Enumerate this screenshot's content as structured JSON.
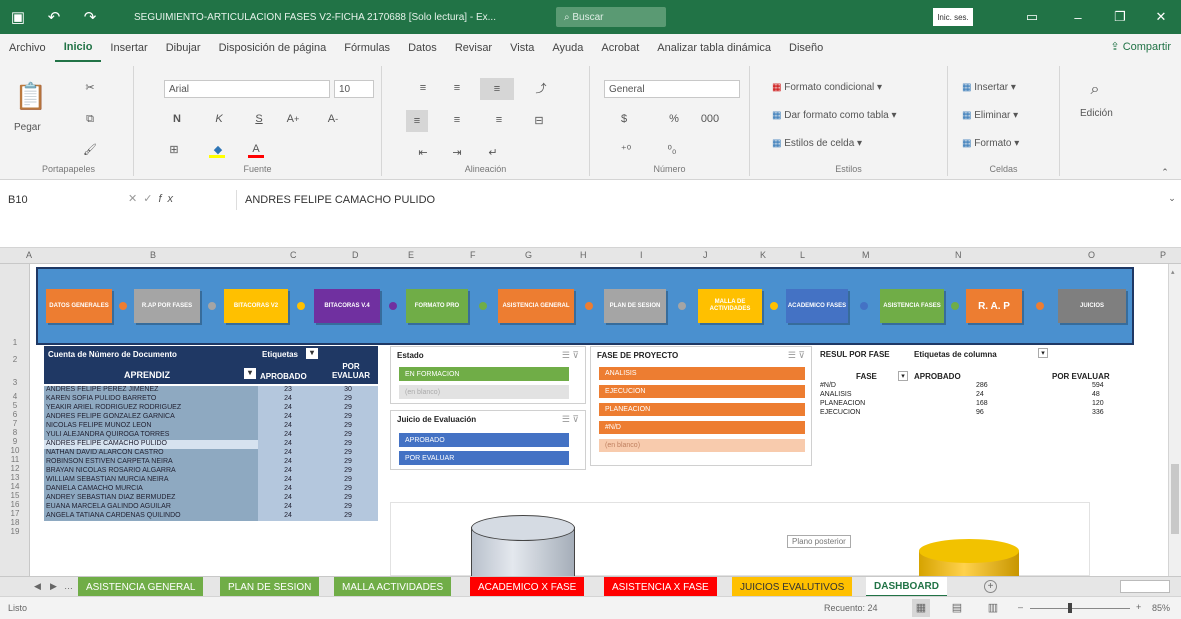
{
  "titlebar": {
    "save_icon": "save-icon",
    "undo_icon": "undo-icon",
    "redo_icon": "redo-icon",
    "doc_title": "SEGUIMIENTO-ARTICULACION FASES V2-FICHA 2170688 [Solo lectura] - Ex...",
    "search_placeholder": "Buscar",
    "user": "Inic. ses.",
    "minimize": "–",
    "restore": "❐",
    "close": "✕"
  },
  "menu": {
    "tabs": [
      "Archivo",
      "Inicio",
      "Insertar",
      "Dibujar",
      "Disposición de página",
      "Fórmulas",
      "Datos",
      "Revisar",
      "Vista",
      "Ayuda",
      "Acrobat",
      "Analizar tabla dinámica",
      "Diseño"
    ],
    "active_index": 1,
    "share": "Compartir"
  },
  "ribbon": {
    "clipboard": {
      "paste": "Pegar",
      "label": "Portapapeles"
    },
    "font": {
      "name": "Arial",
      "size": "10",
      "bold": "N",
      "italic": "K",
      "underline": "S",
      "label": "Fuente"
    },
    "alignment": {
      "label": "Alineación"
    },
    "number": {
      "format": "General",
      "label": "Número"
    },
    "styles": {
      "cond": "Formato condicional",
      "table": "Dar formato como tabla",
      "cell": "Estilos de celda",
      "label": "Estilos"
    },
    "cells": {
      "insert": "Insertar",
      "delete": "Eliminar",
      "format": "Formato",
      "label": "Celdas"
    },
    "editing": {
      "label": "Edición"
    }
  },
  "formula_bar": {
    "cell_ref": "B10",
    "value": "ANDRES FELIPE CAMACHO PULIDO"
  },
  "columns": [
    "A",
    "B",
    "C",
    "D",
    "E",
    "F",
    "G",
    "H",
    "I",
    "J",
    "K",
    "L",
    "M",
    "N",
    "O",
    "P"
  ],
  "rows": [
    "1",
    "2",
    "3",
    "4",
    "5",
    "6",
    "7",
    "8",
    "9",
    "10",
    "11",
    "12",
    "13",
    "14",
    "15",
    "16",
    "17",
    "18",
    "19"
  ],
  "nav_buttons": [
    {
      "label": "DATOS GENERALES",
      "color": "#ed7d31"
    },
    {
      "label": "R.AP POR FASES",
      "color": "#a5a5a5"
    },
    {
      "label": "BITACORAS V2",
      "color": "#ffc000"
    },
    {
      "label": "BITACORAS V.4",
      "color": "#7030a0"
    },
    {
      "label": "FORMATO PRO",
      "color": "#70ad47"
    },
    {
      "label": "ASISTENCIA GENERAL",
      "color": "#ed7d31"
    },
    {
      "label": "PLAN DE SESION",
      "color": "#a5a5a5"
    },
    {
      "label": "MALLA DE ACTIVIDADES",
      "color": "#ffc000"
    },
    {
      "label": "ACADEMICO FASES",
      "color": "#4472c4"
    },
    {
      "label": "ASISTENCIA FASES",
      "color": "#70ad47"
    },
    {
      "label": "R. A. P",
      "color": "#ed7d31"
    },
    {
      "label": "JUICIOS",
      "color": "#7f7f7f"
    }
  ],
  "pivot": {
    "corner": "Cuenta de Número de Documento",
    "col_header": "Etiquetas",
    "row_header": "APRENDIZ",
    "cols": [
      "APROBADO",
      "POR EVALUAR"
    ],
    "rows": [
      {
        "name": "ANDRES FELIPE PEREZ JIMENEZ",
        "a": "23",
        "b": "30"
      },
      {
        "name": "KAREN SOFIA PULIDO BARRETO",
        "a": "24",
        "b": "29"
      },
      {
        "name": "YEAKIR ARIEL RODRIGUEZ RODRIGUEZ",
        "a": "24",
        "b": "29"
      },
      {
        "name": "ANDRES FELIPE GONZALEZ GARNICA",
        "a": "24",
        "b": "29"
      },
      {
        "name": "NICOLAS FELIPE MUÑOZ LEON",
        "a": "24",
        "b": "29"
      },
      {
        "name": "YULI ALEJANDRA QUIROGA TORRES",
        "a": "24",
        "b": "29"
      },
      {
        "name": "ANDRES FELIPE CAMACHO PULIDO",
        "a": "24",
        "b": "29",
        "sel": true
      },
      {
        "name": "NATHAN DAVID ALARCON CASTRO",
        "a": "24",
        "b": "29"
      },
      {
        "name": "ROBINSON ESTIVEN CARPETA NEIRA",
        "a": "24",
        "b": "29"
      },
      {
        "name": "BRAYAN NICOLAS ROSARIO ALGARRA",
        "a": "24",
        "b": "29"
      },
      {
        "name": "WILLIAM SEBASTIAN MURCIA NEIRA",
        "a": "24",
        "b": "29"
      },
      {
        "name": "DANIELA CAMACHO MURCIA",
        "a": "24",
        "b": "29"
      },
      {
        "name": "ANDREY SEBASTIAN DIAZ BERMUDEZ",
        "a": "24",
        "b": "29"
      },
      {
        "name": "EUANA MARCELA GALINDO AGUILAR",
        "a": "24",
        "b": "29"
      },
      {
        "name": "ANGELA TATIANA CARDENAS QUILINDO",
        "a": "24",
        "b": "29"
      }
    ]
  },
  "slicers": {
    "estado": {
      "title": "Estado",
      "items": [
        "EN FORMACION",
        "(en blanco)"
      ]
    },
    "juicio": {
      "title": "Juicio de Evaluación",
      "items": [
        "APROBADO",
        "POR EVALUAR"
      ]
    },
    "fase": {
      "title": "FASE DE PROYECTO",
      "items": [
        "ANALISIS",
        "EJECUCION",
        "PLANEACION",
        "#N/D",
        "(en blanco)"
      ]
    }
  },
  "pivot2": {
    "title": "RESUL POR FASE",
    "col_label": "Etiquetas de columna",
    "head_fase": "FASE",
    "head_a": "APROBADO",
    "head_b": "POR EVALUAR",
    "rows": [
      {
        "fase": "#N/D",
        "a": "286",
        "b": "594"
      },
      {
        "fase": "ANALISIS",
        "a": "24",
        "b": "48"
      },
      {
        "fase": "PLANEACION",
        "a": "168",
        "b": "120"
      },
      {
        "fase": "EJECUCION",
        "a": "96",
        "b": "336"
      }
    ]
  },
  "chart": {
    "tooltip": "Plano posterior"
  },
  "sheet_tabs": [
    {
      "label": "ASISTENCIA GENERAL",
      "bg": "#70ad47",
      "fg": "#fff"
    },
    {
      "label": "PLAN DE SESION",
      "bg": "#70ad47",
      "fg": "#fff"
    },
    {
      "label": "MALLA ACTIVIDADES",
      "bg": "#70ad47",
      "fg": "#fff"
    },
    {
      "label": "ACADEMICO X FASE",
      "bg": "#ff0000",
      "fg": "#fff"
    },
    {
      "label": "ASISTENCIA X FASE",
      "bg": "#ff0000",
      "fg": "#fff"
    },
    {
      "label": "JUICIOS EVALUTIVOS",
      "bg": "#ffc000",
      "fg": "#333"
    },
    {
      "label": "DASHBOARD",
      "bg": "#ffffff",
      "fg": "#217346"
    }
  ],
  "status": {
    "ready": "Listo",
    "count": "Recuento: 24",
    "zoom": "85%"
  }
}
